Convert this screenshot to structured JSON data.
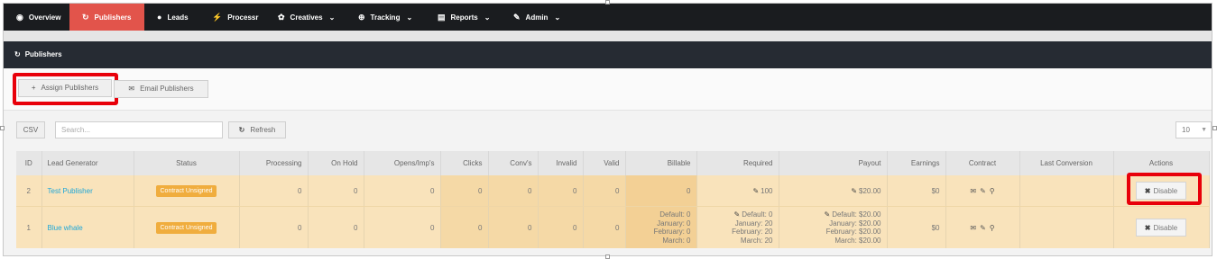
{
  "nav": [
    {
      "label": "Overview",
      "icon": "eye-icon",
      "glyph": "◉",
      "dropdown": false,
      "active": false
    },
    {
      "label": "Publishers",
      "icon": "publishers-icon",
      "glyph": "↻",
      "dropdown": false,
      "active": true
    },
    {
      "label": "Leads",
      "icon": "user-icon",
      "glyph": "●",
      "dropdown": false,
      "active": false
    },
    {
      "label": "Processr",
      "icon": "bolt-icon",
      "glyph": "⚡",
      "dropdown": false,
      "active": false
    },
    {
      "label": "Creatives",
      "icon": "palette-icon",
      "glyph": "✿",
      "dropdown": true,
      "active": false
    },
    {
      "label": "Tracking",
      "icon": "crosshair-icon",
      "glyph": "⊕",
      "dropdown": true,
      "active": false
    },
    {
      "label": "Reports",
      "icon": "document-icon",
      "glyph": "▤",
      "dropdown": true,
      "active": false
    },
    {
      "label": "Admin",
      "icon": "wrench-icon",
      "glyph": "✎",
      "dropdown": true,
      "active": false
    }
  ],
  "page": {
    "title": "Publishers"
  },
  "actions": {
    "assign": "Assign Publishers",
    "email": "Email Publishers"
  },
  "toolbar": {
    "csv": "CSV",
    "search_placeholder": "Search...",
    "refresh": "Refresh",
    "page_size": "10"
  },
  "table": {
    "headers": [
      "ID",
      "Lead Generator",
      "Status",
      "Processing",
      "On Hold",
      "Opens/Imp's",
      "Clicks",
      "Conv's",
      "Invalid",
      "Valid",
      "Billable",
      "Required",
      "Payout",
      "Earnings",
      "Contract",
      "Last Conversion",
      "Actions"
    ],
    "rows": [
      {
        "id": "2",
        "lead_generator": "Test Publisher",
        "status": "Contract Unsigned",
        "processing": "0",
        "on_hold": "0",
        "opens": "0",
        "clicks": "0",
        "convs": "0",
        "invalid": "0",
        "valid": "0",
        "billable": [
          "0"
        ],
        "required": [
          "100"
        ],
        "payout": [
          "$20.00"
        ],
        "earnings": "$0",
        "last_conversion": "",
        "action": "Disable"
      },
      {
        "id": "1",
        "lead_generator": "Blue whale",
        "status": "Contract Unsigned",
        "processing": "0",
        "on_hold": "0",
        "opens": "0",
        "clicks": "0",
        "convs": "0",
        "invalid": "0",
        "valid": "0",
        "billable": [
          "Default: 0",
          "January: 0",
          "February: 0",
          "March: 0"
        ],
        "required": [
          "Default: 0",
          "January: 20",
          "February: 20",
          "March: 20"
        ],
        "payout": [
          "Default: $20.00",
          "January: $20.00",
          "February: $20.00",
          "March: $20.00"
        ],
        "earnings": "$0",
        "last_conversion": "",
        "action": "Disable"
      }
    ]
  },
  "colors": {
    "nav_bg": "#1a1c1f",
    "nav_active": "#e2544b",
    "header_bg": "#262b33",
    "row_bg": "#f9e3bb",
    "badge": "#f0ad3e",
    "link": "#1ea7d8",
    "highlight": "#e8000a"
  }
}
